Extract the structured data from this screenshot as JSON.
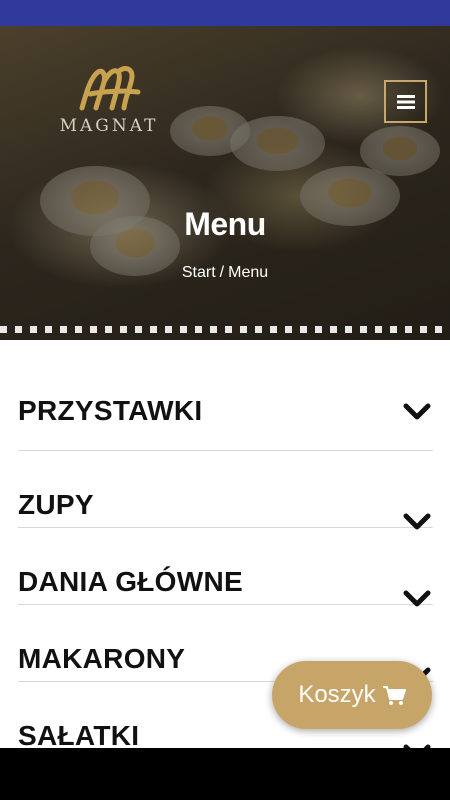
{
  "header": {
    "logo_text": "MAGNAT"
  },
  "hero": {
    "title": "Menu",
    "breadcrumb": {
      "home": "Start",
      "separator": "/",
      "current": "Menu"
    }
  },
  "categories": [
    {
      "label": "PRZYSTAWKI"
    },
    {
      "label": "ZUPY"
    },
    {
      "label": "DANIA GŁÓWNE"
    },
    {
      "label": "MAKARONY"
    },
    {
      "label": "SAŁATKI"
    }
  ],
  "cart": {
    "label": "Koszyk",
    "icon": "cart-icon"
  },
  "colors": {
    "status_bar": "#2f3a9c",
    "accent_gold": "#c7a468",
    "text_dark": "#111111"
  }
}
